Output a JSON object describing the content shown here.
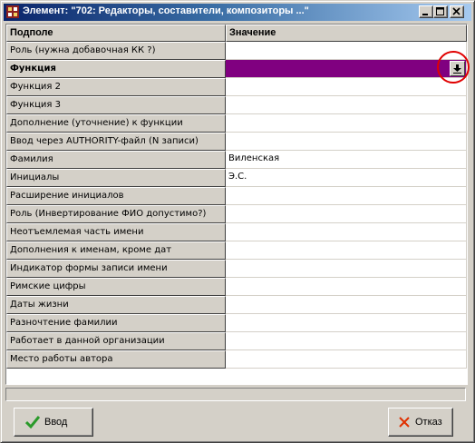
{
  "window": {
    "title": "Элемент: \"702: Редакторы, составители, композиторы ...\""
  },
  "grid": {
    "headers": {
      "field": "Подполе",
      "value": "Значение"
    },
    "rows": [
      {
        "field": "Роль (нужна добавочная КК ?)",
        "value": ""
      },
      {
        "field": "Функция",
        "value": ""
      },
      {
        "field": "Функция 2",
        "value": ""
      },
      {
        "field": "Функция 3",
        "value": ""
      },
      {
        "field": "Дополнение (уточнение) к функции",
        "value": ""
      },
      {
        "field": "Ввод через AUTHORITY-файл (N записи)",
        "value": ""
      },
      {
        "field": "Фамилия",
        "value": "Виленская"
      },
      {
        "field": "Инициалы",
        "value": "Э.С."
      },
      {
        "field": "Расширение инициалов",
        "value": ""
      },
      {
        "field": "Роль (Инвертирование ФИО допустимо?)",
        "value": ""
      },
      {
        "field": "Неотъемлемая часть имени",
        "value": ""
      },
      {
        "field": "Дополнения к именам, кроме дат",
        "value": ""
      },
      {
        "field": "Индикатор формы записи имени",
        "value": ""
      },
      {
        "field": "Римские цифры",
        "value": ""
      },
      {
        "field": "Даты жизни",
        "value": ""
      },
      {
        "field": "Разночтение фамилии",
        "value": ""
      },
      {
        "field": "Работает в данной организации",
        "value": ""
      },
      {
        "field": "Место работы автора",
        "value": ""
      }
    ],
    "selected_row": 1,
    "selected_color": "#800080"
  },
  "buttons": {
    "ok_label": "Ввод",
    "cancel_label": "Отказ"
  },
  "icons": {
    "title": "app-icon",
    "dropdown": "dropdown-arrow-icon",
    "ok": "checkmark-icon",
    "cancel": "cross-icon"
  },
  "colors": {
    "titlebar_start": "#0a246a",
    "titlebar_end": "#a6caf0",
    "annotation_ring": "#e00000",
    "ok_check": "#2a9a2a",
    "cancel_cross": "#e03000"
  }
}
